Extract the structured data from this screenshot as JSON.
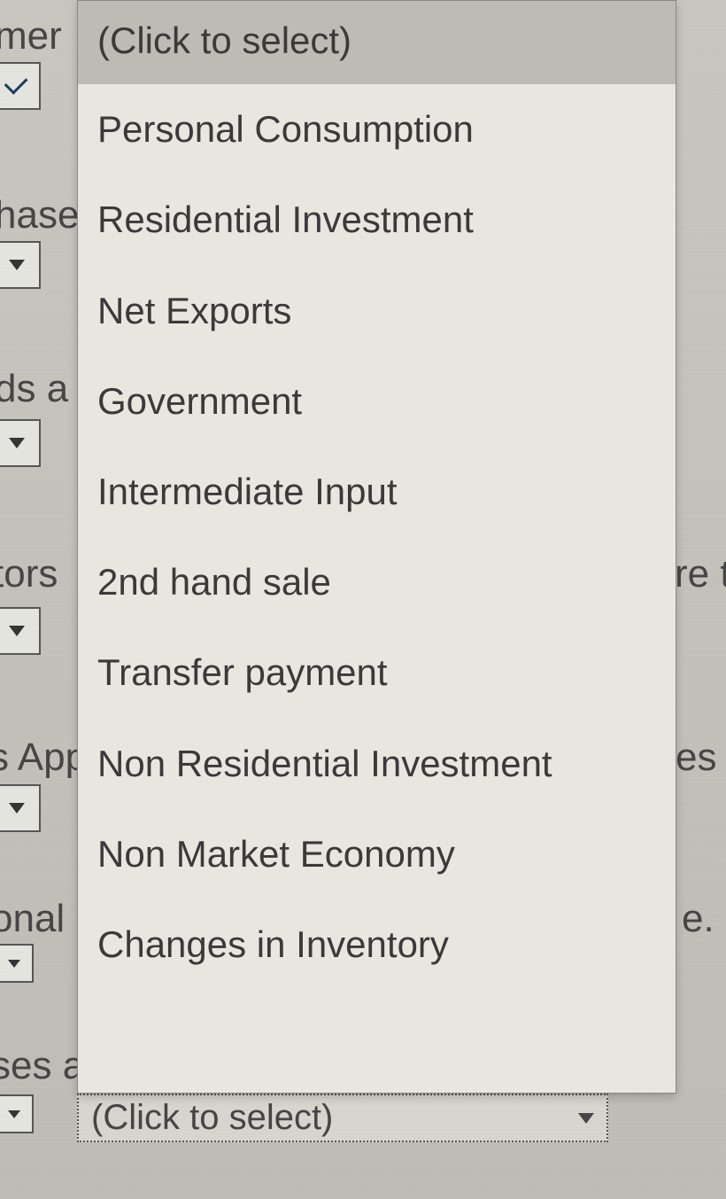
{
  "background": {
    "row1_text": "mer",
    "row2_text": "hase",
    "row3_text": "ds a",
    "row4_text_left": "tors",
    "row4_text_right": "re t",
    "row5_text_left": "s App",
    "row5_text_right": "es fr",
    "row6_text_left": "onal",
    "row6_text_right": "e.",
    "row7_text": "ses a"
  },
  "bottom_select": {
    "value": "(Click to select)"
  },
  "dropdown": {
    "options": [
      "(Click to select)",
      "Personal Consumption",
      "Residential Investment",
      "Net Exports",
      "Government",
      "Intermediate Input",
      "2nd hand sale",
      "Transfer payment",
      "Non Residential Investment",
      "Non Market Economy",
      "Changes in Inventory"
    ]
  }
}
